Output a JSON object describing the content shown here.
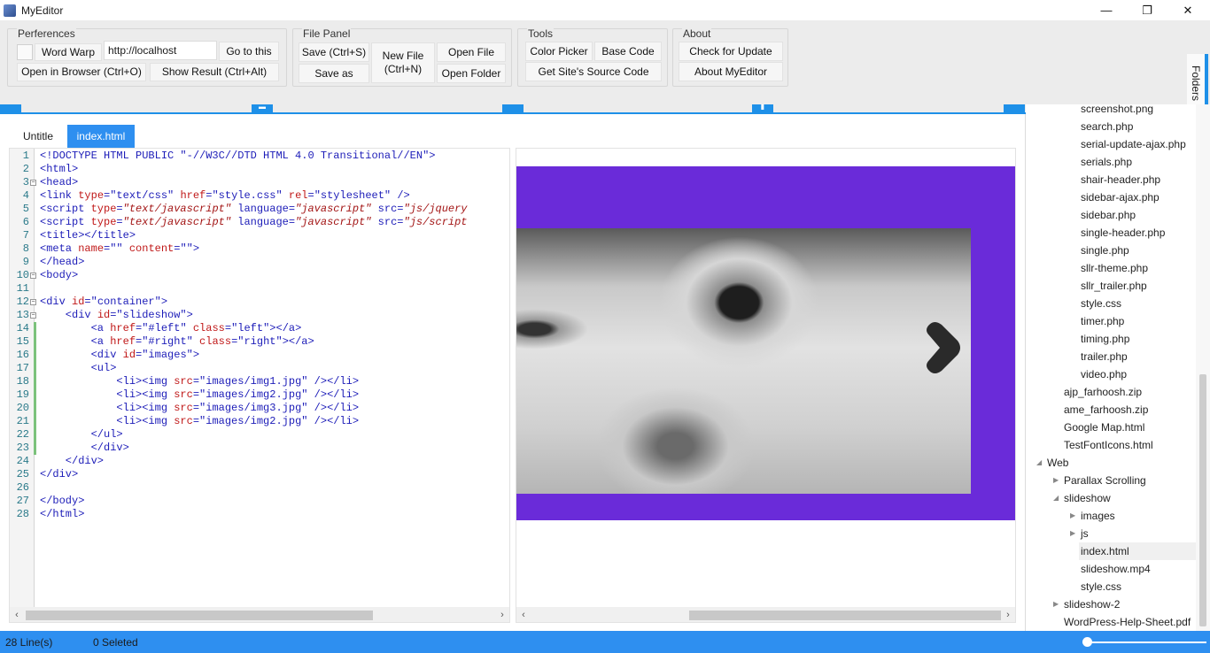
{
  "window": {
    "title": "MyEditor",
    "minimize_glyph": "—",
    "maximize_glyph": "❐",
    "close_glyph": "✕"
  },
  "ribbon": {
    "preferences": {
      "title": "Perferences",
      "word_wrap": "Word Warp",
      "url_value": "http://localhost",
      "go_to": "Go to this",
      "open_in_browser": "Open in Browser (Ctrl+O)",
      "show_result": "Show Result (Ctrl+Alt)"
    },
    "file_panel": {
      "title": "File Panel",
      "save": "Save (Ctrl+S)",
      "save_as": "Save as",
      "new_file_1": "New File",
      "new_file_2": "(Ctrl+N)",
      "open_file": "Open File",
      "open_folder": "Open Folder"
    },
    "tools": {
      "title": "Tools",
      "color_picker": "Color Picker",
      "base_code": "Base Code",
      "source_code": "Get Site's Source Code"
    },
    "about": {
      "title": "About",
      "check_update": "Check for Update",
      "about_app": "About MyEditor"
    },
    "folders_tab": "Folders"
  },
  "tabs": [
    {
      "label": "Untitle",
      "active": false
    },
    {
      "label": "index.html",
      "active": true
    }
  ],
  "editor": {
    "line_numbers": [
      "1",
      "2",
      "3",
      "4",
      "5",
      "6",
      "7",
      "8",
      "9",
      "10",
      "11",
      "12",
      "13",
      "14",
      "15",
      "16",
      "17",
      "18",
      "19",
      "20",
      "21",
      "22",
      "23",
      "24",
      "25",
      "26",
      "27",
      "28"
    ],
    "lines": [
      [
        [
          "t",
          "<!DOCTYPE HTML PUBLIC \"-//W3C//DTD HTML 4.0 Transitional//EN\">"
        ]
      ],
      [
        [
          "t",
          "<html>"
        ]
      ],
      [
        [
          "t",
          "<head>"
        ]
      ],
      [
        [
          "t",
          "<link "
        ],
        [
          "a",
          "type"
        ],
        [
          "t",
          "="
        ],
        [
          "v",
          "\"text/css\""
        ],
        [
          "t",
          " "
        ],
        [
          "a",
          "href"
        ],
        [
          "t",
          "="
        ],
        [
          "v",
          "\"style.css\""
        ],
        [
          "t",
          " "
        ],
        [
          "a",
          "rel"
        ],
        [
          "t",
          "="
        ],
        [
          "v",
          "\"stylesheet\""
        ],
        [
          "t",
          " />"
        ]
      ],
      [
        [
          "t",
          "<script "
        ],
        [
          "a",
          "type"
        ],
        [
          "t",
          "="
        ],
        [
          "i",
          "\"text/javascript\""
        ],
        [
          "t",
          " language="
        ],
        [
          "i",
          "\"javascript\""
        ],
        [
          "t",
          " src="
        ],
        [
          "i",
          "\"js/jquery"
        ]
      ],
      [
        [
          "t",
          "<script "
        ],
        [
          "a",
          "type"
        ],
        [
          "t",
          "="
        ],
        [
          "i",
          "\"text/javascript\""
        ],
        [
          "t",
          " language="
        ],
        [
          "i",
          "\"javascript\""
        ],
        [
          "t",
          " src="
        ],
        [
          "i",
          "\"js/script"
        ]
      ],
      [
        [
          "t",
          "<title></title>"
        ]
      ],
      [
        [
          "t",
          "<meta "
        ],
        [
          "a",
          "name"
        ],
        [
          "t",
          "="
        ],
        [
          "v",
          "\"\""
        ],
        [
          "t",
          " "
        ],
        [
          "a",
          "content"
        ],
        [
          "t",
          "="
        ],
        [
          "v",
          "\"\""
        ],
        [
          "t",
          ">"
        ]
      ],
      [
        [
          "t",
          "</head>"
        ]
      ],
      [
        [
          "t",
          "<body>"
        ]
      ],
      [],
      [
        [
          "t",
          "<div "
        ],
        [
          "a",
          "id"
        ],
        [
          "t",
          "="
        ],
        [
          "v",
          "\"container\""
        ],
        [
          "t",
          ">"
        ]
      ],
      [
        [
          "t",
          "    <div "
        ],
        [
          "a",
          "id"
        ],
        [
          "t",
          "="
        ],
        [
          "v",
          "\"slideshow\""
        ],
        [
          "t",
          ">"
        ]
      ],
      [
        [
          "t",
          "        <a "
        ],
        [
          "a",
          "href"
        ],
        [
          "t",
          "="
        ],
        [
          "v",
          "\"#left\""
        ],
        [
          "t",
          " "
        ],
        [
          "a",
          "class"
        ],
        [
          "t",
          "="
        ],
        [
          "v",
          "\"left\""
        ],
        [
          "t",
          "></a>"
        ]
      ],
      [
        [
          "t",
          "        <a "
        ],
        [
          "a",
          "href"
        ],
        [
          "t",
          "="
        ],
        [
          "v",
          "\"#right\""
        ],
        [
          "t",
          " "
        ],
        [
          "a",
          "class"
        ],
        [
          "t",
          "="
        ],
        [
          "v",
          "\"right\""
        ],
        [
          "t",
          "></a>"
        ]
      ],
      [
        [
          "t",
          "        <div "
        ],
        [
          "a",
          "id"
        ],
        [
          "t",
          "="
        ],
        [
          "v",
          "\"images\""
        ],
        [
          "t",
          ">"
        ]
      ],
      [
        [
          "t",
          "        <ul>"
        ]
      ],
      [
        [
          "t",
          "            <li><img "
        ],
        [
          "a",
          "src"
        ],
        [
          "t",
          "="
        ],
        [
          "v",
          "\"images/img1.jpg\""
        ],
        [
          "t",
          " /></li>"
        ]
      ],
      [
        [
          "t",
          "            <li><img "
        ],
        [
          "a",
          "src"
        ],
        [
          "t",
          "="
        ],
        [
          "v",
          "\"images/img2.jpg\""
        ],
        [
          "t",
          " /></li>"
        ]
      ],
      [
        [
          "t",
          "            <li><img "
        ],
        [
          "a",
          "src"
        ],
        [
          "t",
          "="
        ],
        [
          "v",
          "\"images/img3.jpg\""
        ],
        [
          "t",
          " /></li>"
        ]
      ],
      [
        [
          "t",
          "            <li><img "
        ],
        [
          "a",
          "src"
        ],
        [
          "t",
          "="
        ],
        [
          "v",
          "\"images/img2.jpg\""
        ],
        [
          "t",
          " /></li>"
        ]
      ],
      [
        [
          "t",
          "        </ul>"
        ]
      ],
      [
        [
          "t",
          "        </div>"
        ]
      ],
      [
        [
          "t",
          "    </div>"
        ]
      ],
      [
        [
          "t",
          "</div>"
        ]
      ],
      [],
      [
        [
          "t",
          "</body>"
        ]
      ],
      [
        [
          "t",
          "</html>"
        ]
      ]
    ],
    "folded_lines": [
      3,
      10,
      12,
      13
    ],
    "changed_lines": [
      14,
      15,
      16,
      17,
      18,
      19,
      20,
      21,
      22,
      23
    ]
  },
  "preview": {
    "image_icon": "slideshow-right-arrow-icon"
  },
  "sidebar": {
    "items": [
      {
        "label": "screenshot.png",
        "depth": 3
      },
      {
        "label": "search.php",
        "depth": 3
      },
      {
        "label": "serial-update-ajax.php",
        "depth": 3
      },
      {
        "label": "serials.php",
        "depth": 3
      },
      {
        "label": "shair-header.php",
        "depth": 3
      },
      {
        "label": "sidebar-ajax.php",
        "depth": 3
      },
      {
        "label": "sidebar.php",
        "depth": 3
      },
      {
        "label": "single-header.php",
        "depth": 3
      },
      {
        "label": "single.php",
        "depth": 3
      },
      {
        "label": "sllr-theme.php",
        "depth": 3
      },
      {
        "label": "sllr_trailer.php",
        "depth": 3
      },
      {
        "label": "style.css",
        "depth": 3
      },
      {
        "label": "timer.php",
        "depth": 3
      },
      {
        "label": "timing.php",
        "depth": 3
      },
      {
        "label": "trailer.php",
        "depth": 3
      },
      {
        "label": "video.php",
        "depth": 3
      },
      {
        "label": "ajp_farhoosh.zip",
        "depth": 2
      },
      {
        "label": "ame_farhoosh.zip",
        "depth": 2
      },
      {
        "label": "Google Map.html",
        "depth": 2
      },
      {
        "label": "TestFontIcons.html",
        "depth": 2
      },
      {
        "label": "Web",
        "depth": 1,
        "toggle": "expanded"
      },
      {
        "label": "Parallax Scrolling",
        "depth": 2,
        "toggle": "collapsed"
      },
      {
        "label": "slideshow",
        "depth": 2,
        "toggle": "expanded"
      },
      {
        "label": "images",
        "depth": 3,
        "toggle": "collapsed"
      },
      {
        "label": "js",
        "depth": 3,
        "toggle": "collapsed"
      },
      {
        "label": "index.html",
        "depth": 3,
        "selected": true
      },
      {
        "label": "slideshow.mp4",
        "depth": 3
      },
      {
        "label": "style.css",
        "depth": 3
      },
      {
        "label": "slideshow-2",
        "depth": 2,
        "toggle": "collapsed"
      },
      {
        "label": "WordPress-Help-Sheet.pdf",
        "depth": 2
      }
    ]
  },
  "status": {
    "lines": "28 Line(s)",
    "selected": "0 Seleted",
    "zoom_level": 0.02
  },
  "colors": {
    "accent": "#2e8ff0",
    "preview_bg": "#6a2bd9"
  }
}
